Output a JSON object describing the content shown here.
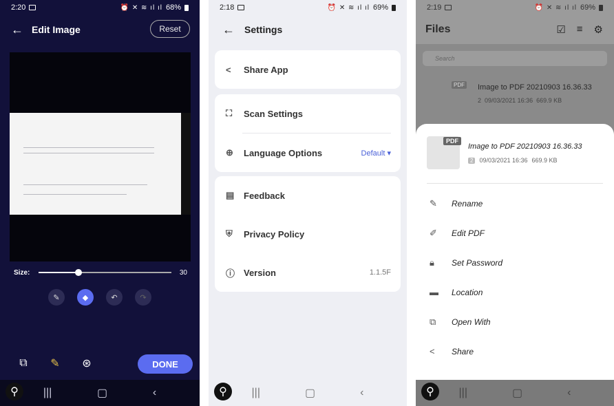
{
  "panel1": {
    "status": {
      "time": "2:20",
      "battery": "68%"
    },
    "title": "Edit Image",
    "reset_label": "Reset",
    "size_label": "Size:",
    "size_value": "30",
    "slider_fraction": 0.3,
    "done_label": "DONE"
  },
  "panel2": {
    "status": {
      "time": "2:18",
      "battery": "69%"
    },
    "title": "Settings",
    "items": {
      "share": "Share App",
      "scan": "Scan Settings",
      "language": "Language Options",
      "language_value": "Default",
      "feedback": "Feedback",
      "privacy": "Privacy Policy",
      "version": "Version",
      "version_value": "1.1.5F"
    }
  },
  "panel3": {
    "status": {
      "time": "2:19",
      "battery": "69%"
    },
    "title": "Files",
    "search_placeholder": "Search",
    "bg_file": {
      "badge": "PDF",
      "name": "Image to PDF 20210903 16.36.33",
      "pages": "2",
      "date": "09/03/2021 16:36",
      "size": "669.9 KB"
    },
    "sheet_file": {
      "badge": "PDF",
      "name": "Image to PDF 20210903 16.36.33",
      "pages": "2",
      "date": "09/03/2021 16:36",
      "size": "669.9 KB"
    },
    "menu": [
      "Rename",
      "Edit PDF",
      "Set Password",
      "Location",
      "Open With",
      "Share"
    ]
  }
}
